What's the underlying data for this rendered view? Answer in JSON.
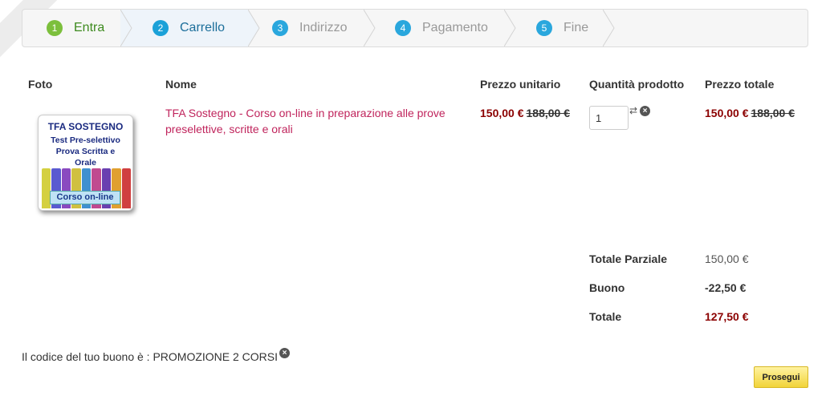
{
  "steps": [
    {
      "number": "1",
      "label": "Entra",
      "state": "done"
    },
    {
      "number": "2",
      "label": "Carrello",
      "state": "active"
    },
    {
      "number": "3",
      "label": "Indirizzo",
      "state": "todo"
    },
    {
      "number": "4",
      "label": "Pagamento",
      "state": "todo"
    },
    {
      "number": "5",
      "label": "Fine",
      "state": "todo"
    }
  ],
  "table": {
    "headers": {
      "photo": "Foto",
      "name": "Nome",
      "unit_price": "Prezzo unitario",
      "quantity": "Quantità prodotto",
      "total_price": "Prezzo totale"
    },
    "row": {
      "thumbnail": {
        "title": "TFA SOSTEGNO",
        "subtitle_1": "Test Pre-selettivo",
        "subtitle_2": "Prova Scritta e",
        "subtitle_3": "Orale",
        "band": "Corso on-line"
      },
      "name": "TFA Sostegno - Corso on-line in preparazione alle prove preselettive, scritte e orali",
      "unit_price_new": "150,00 €",
      "unit_price_old": "188,00 €",
      "quantity": "1",
      "total_price_new": "150,00 €",
      "total_price_old": "188,00 €"
    }
  },
  "summary": {
    "subtotal_label": "Totale Parziale",
    "subtotal_value": "150,00 €",
    "voucher_label": "Buono",
    "voucher_value": "-22,50 €",
    "total_label": "Totale",
    "total_value": "127,50 €"
  },
  "coupon": {
    "text": "Il codice del tuo buono è : PROMOZIONE 2 CORSI"
  },
  "continue_button": "Prosegui",
  "colors": {
    "done_step": "#7cbf3c",
    "active_step": "#1ba1d8",
    "product_link": "#c0245c",
    "price_new": "#8b0000",
    "button": "#f1d33a"
  }
}
